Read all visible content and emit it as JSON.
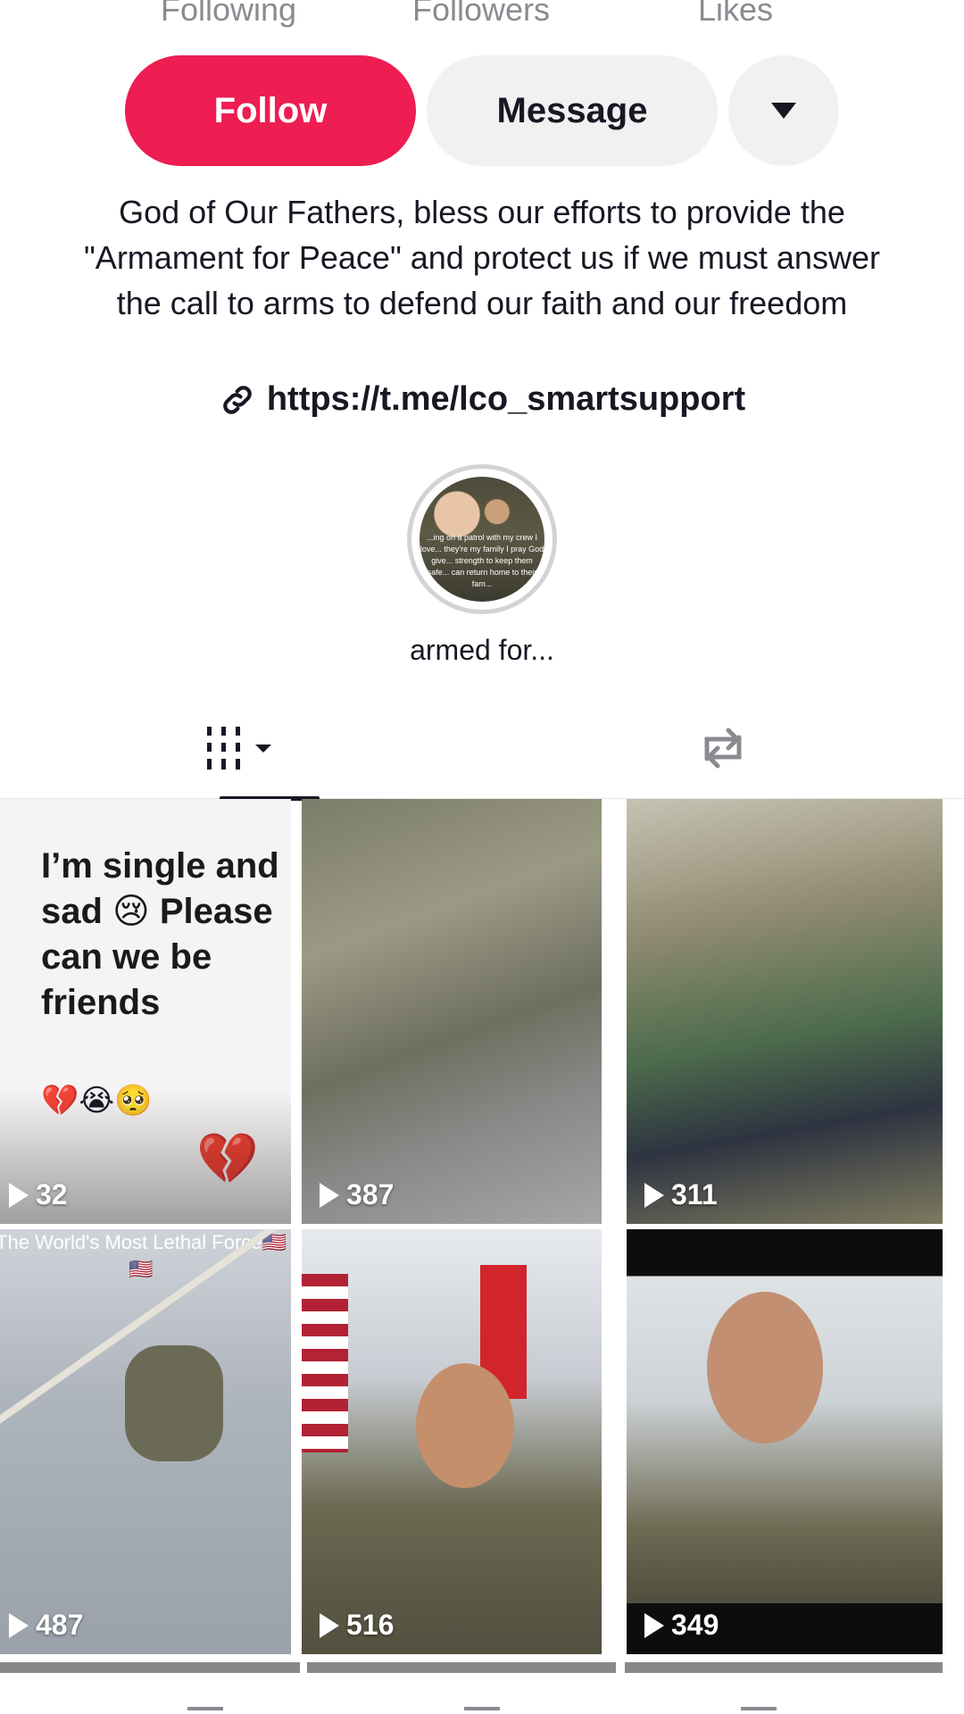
{
  "stats": {
    "following_label": "Following",
    "followers_label": "Followers",
    "likes_label": "Likes"
  },
  "actions": {
    "follow_label": "Follow",
    "message_label": "Message",
    "more_icon": "caret-down-icon"
  },
  "bio": {
    "text": "God of Our Fathers, bless our efforts to provide the \"Armament for Peace\" and protect us if we must answer the call to arms to defend our faith and our freedom",
    "link": "https://t.me/lco_smartsupport"
  },
  "highlight": {
    "label": "armed for...",
    "overlay_text": "...ing on a patrol with my crew I love... they're my family I pray God give... strength to keep them safe... can return home to their fam..."
  },
  "tabs": {
    "videos_icon": "grid-icon",
    "reposts_icon": "repost-icon"
  },
  "videos": [
    {
      "views": "32",
      "caption": "I’m single and sad 😢 Please can we be friends",
      "emoji": "💔😭🥺",
      "heart": "💔"
    },
    {
      "views": "387"
    },
    {
      "views": "311"
    },
    {
      "views": "487",
      "top_text": "The World's Most Lethal Force🇺🇸🇺🇸"
    },
    {
      "views": "516"
    },
    {
      "views": "349"
    }
  ]
}
